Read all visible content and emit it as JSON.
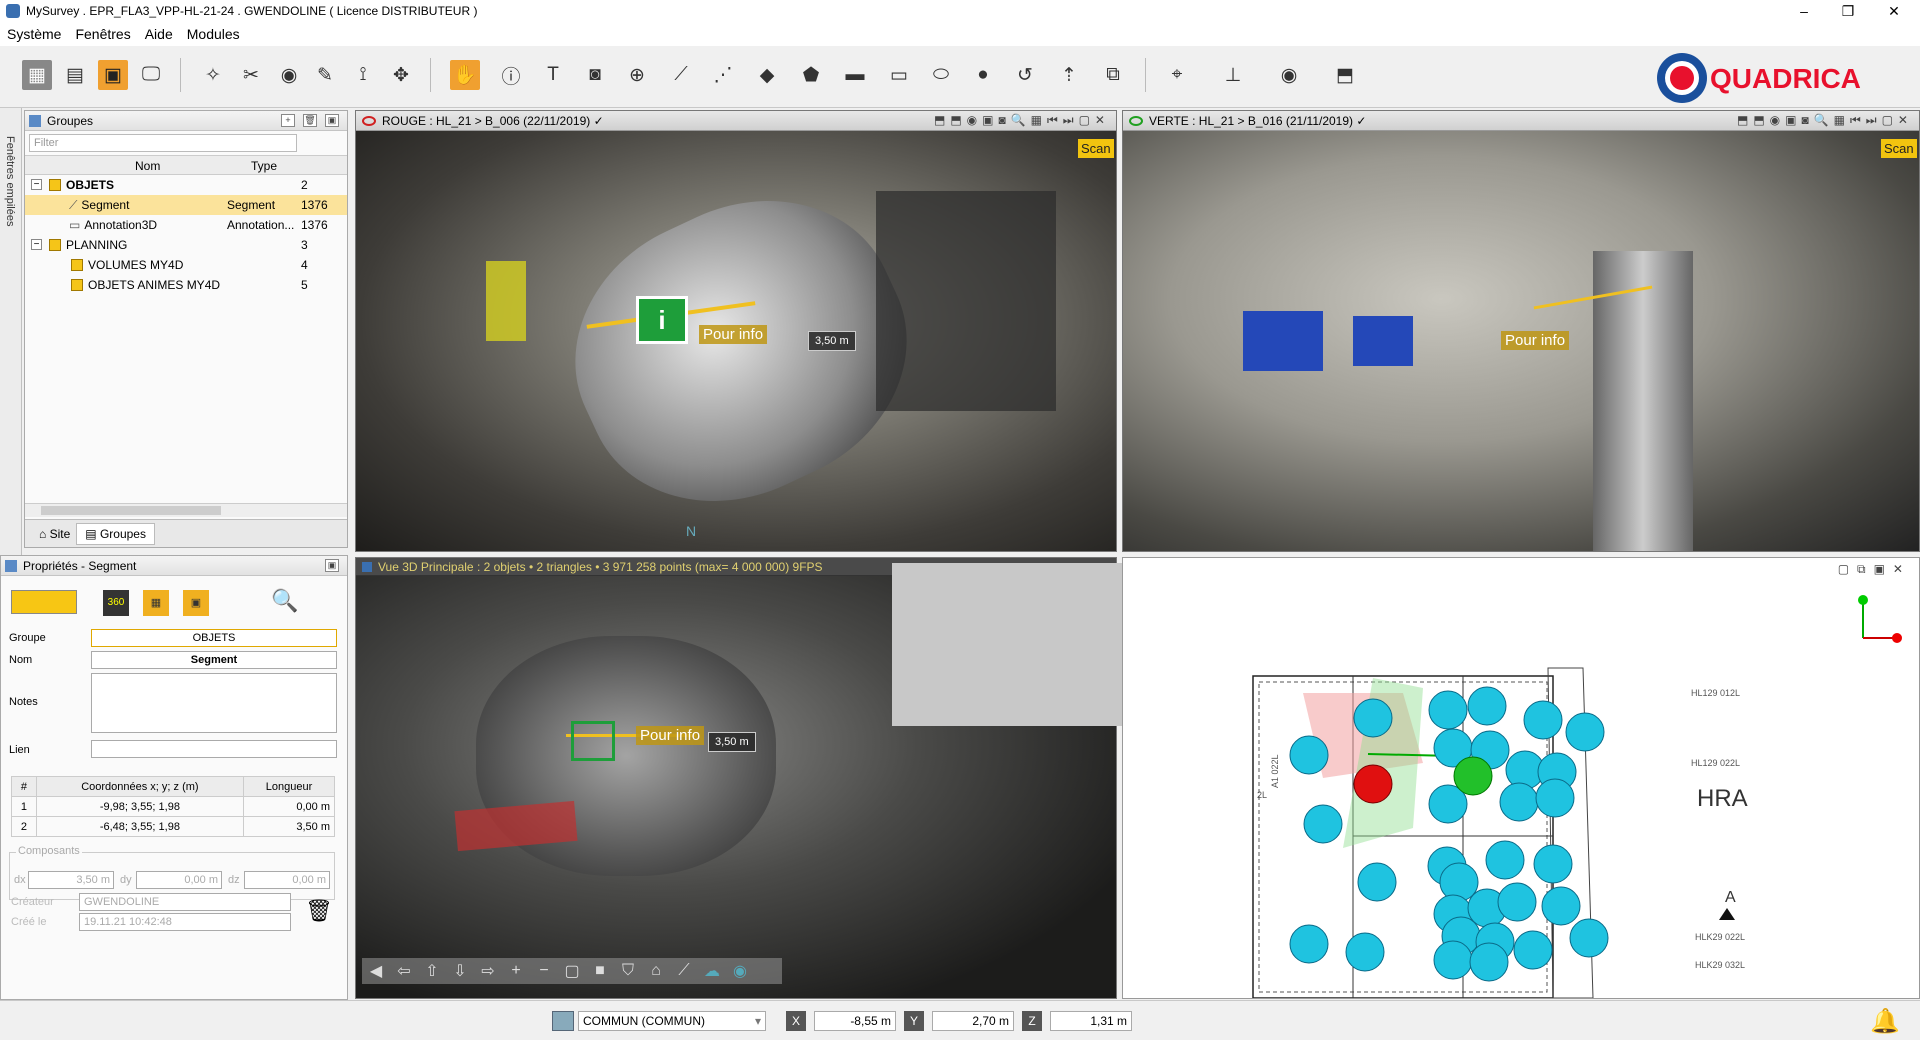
{
  "window": {
    "title": "MySurvey . EPR_FLA3_VPP-HL-21-24 . GWENDOLINE ( Licence DISTRIBUTEUR )"
  },
  "menu": [
    "Système",
    "Fenêtres",
    "Aide",
    "Modules"
  ],
  "logo": {
    "text": "QUADRICA",
    "accent": "#e8112d",
    "blue": "#1a4f9c"
  },
  "groups_panel": {
    "title": "Groupes",
    "filter_placeholder": "Filter",
    "columns": [
      "Nom",
      "Type"
    ],
    "side_tab": "Fenêtres empilées",
    "rows": [
      {
        "name": "OBJETS",
        "type": "",
        "count": "2"
      },
      {
        "name": "Segment",
        "type": "Segment",
        "count": "1376"
      },
      {
        "name": "Annotation3D",
        "type": "Annotation...",
        "count": "1376"
      },
      {
        "name": "PLANNING",
        "type": "",
        "count": "3"
      },
      {
        "name": "VOLUMES MY4D",
        "type": "",
        "count": "4"
      },
      {
        "name": "OBJETS ANIMES MY4D",
        "type": "",
        "count": "5"
      }
    ],
    "tabs": [
      "Site",
      "Groupes"
    ]
  },
  "properties_panel": {
    "title": "Propriétés - Segment",
    "groupe_label": "Groupe",
    "groupe_value": "OBJETS",
    "nom_label": "Nom",
    "nom_value": "Segment",
    "notes_label": "Notes",
    "lien_label": "Lien",
    "coords_headers": [
      "#",
      "Coordonnées x; y; z (m)",
      "Longueur"
    ],
    "coords": [
      {
        "idx": "1",
        "xyz": "-9,98; 3,55; 1,98",
        "len": "0,00 m"
      },
      {
        "idx": "2",
        "xyz": "-6,48; 3,55; 1,98",
        "len": "3,50 m"
      }
    ],
    "composants_label": "Composants",
    "dx_label": "dx",
    "dx_value": "3,50 m",
    "dy_label": "dy",
    "dy_value": "0,00 m",
    "dz_label": "dz",
    "dz_value": "0,00 m",
    "createur_label": "Créateur",
    "createur_value": "GWENDOLINE",
    "cree_label": "Créé le",
    "cree_value": "19.11.21 10:42:48"
  },
  "viewport_red": {
    "title": "ROUGE : HL_21 > B_006 (22/11/2019) ✓",
    "label": "Pour info",
    "distance": "3,50 m",
    "scan": "Scan",
    "compass": "N"
  },
  "viewport_green": {
    "title": "VERTE : HL_21 > B_016 (21/11/2019) ✓",
    "label": "Pour info",
    "scan": "Scan"
  },
  "viewport_3d": {
    "title": "Vue 3D Principale : 2 objets • 2 triangles • 3 971 258 points (max= 4 000 000) 9FPS",
    "label": "Pour info",
    "distance": "3,50 m"
  },
  "plan_view": {
    "label_hra": "HRA",
    "label_a": "A",
    "labels_right": [
      "HL129 012L",
      "HL129 022L",
      "HLK29 022L",
      "HLK29 032L"
    ],
    "labels_left": [
      "2L",
      "A1 022L"
    ]
  },
  "statusbar": {
    "layer": "COMMUN (COMMUN)",
    "x_label": "X",
    "x_value": "-8,55 m",
    "y_label": "Y",
    "y_value": "2,70 m",
    "z_label": "Z",
    "z_value": "1,31 m"
  },
  "colors": {
    "accent_orange": "#f0a030",
    "label_yellow": "#c9a21b",
    "marker_blue": "#1fc3e0",
    "marker_red": "#e01010",
    "marker_green": "#22c02a"
  }
}
